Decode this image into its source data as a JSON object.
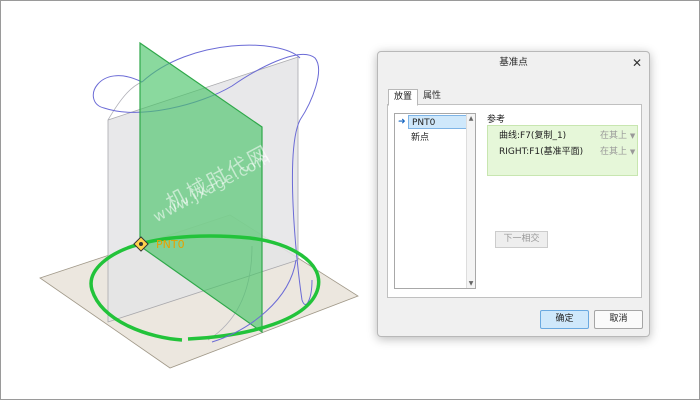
{
  "viewport": {
    "point_label": "PNT0",
    "watermark_line1": "机械时代网",
    "watermark_line2": "www.jxage.com",
    "colors": {
      "plane": "#4cc46a",
      "curve": "#22c33a",
      "sketch_curve": "#6b6bd6",
      "datum": "#e8a000"
    }
  },
  "dialog": {
    "title": "基准点",
    "tabs": [
      "放置",
      "属性"
    ],
    "points": [
      "PNT0",
      "新点"
    ],
    "reference_label": "参考",
    "references": [
      {
        "name": "曲线:F7(复制_1)",
        "type": "在其上"
      },
      {
        "name": "RIGHT:F1(基准平面)",
        "type": "在其上"
      }
    ],
    "next_button": "下一相交",
    "ok": "确定",
    "cancel": "取消",
    "icons": {
      "close": "close-icon",
      "selected": "arrow-right-icon",
      "dropdown": "caret-down-icon"
    }
  }
}
